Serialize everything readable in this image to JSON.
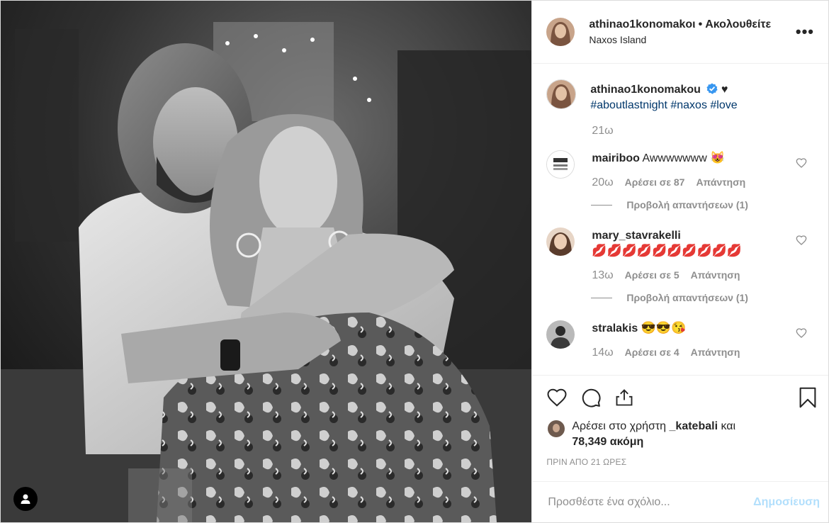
{
  "header": {
    "username": "athinao1konomakoι",
    "separator": "•",
    "follow_label": "Ακολουθείτε",
    "location": "Naxos Island",
    "more_label": "•••"
  },
  "caption": {
    "username": "athinao1konomakou",
    "suffix": "♥",
    "hashtags": [
      "#aboutlastnight",
      "#naxos",
      "#love"
    ],
    "time": "21ω"
  },
  "comments": [
    {
      "username": "mairiboo",
      "text": "Awwwwwww",
      "emoji": "😻",
      "time": "20ω",
      "likes": "Αρέσει σε 87",
      "reply": "Απάντηση",
      "view_replies": "Προβολή απαντήσεων (1)"
    },
    {
      "username": "mary_stavrakelli",
      "text": "",
      "emoji": "💋💋💋💋💋💋💋💋💋💋",
      "time": "13ω",
      "likes": "Αρέσει σε 5",
      "reply": "Απάντηση",
      "view_replies": "Προβολή απαντήσεων (1)"
    },
    {
      "username": "stralakis",
      "text": "",
      "emoji": "😎😎😘",
      "time": "14ω",
      "likes": "Αρέσει σε 4",
      "reply": "Απάντηση",
      "view_replies": ""
    }
  ],
  "likes": {
    "prefix": "Αρέσει στο χρήστη",
    "user": "_katebali",
    "conj": "και",
    "count": "78,349 ακόμη"
  },
  "date": "ΠΡΙΝ ΑΠΟ 21 ΩΡΕΣ",
  "add_comment": {
    "placeholder": "Προσθέστε ένα σχόλιο...",
    "post_label": "Δημοσίευση"
  },
  "colors": {
    "link": "#00376b",
    "muted": "#8e8e8e",
    "verified": "#3897f0",
    "post_disabled": "#b2dffc"
  }
}
